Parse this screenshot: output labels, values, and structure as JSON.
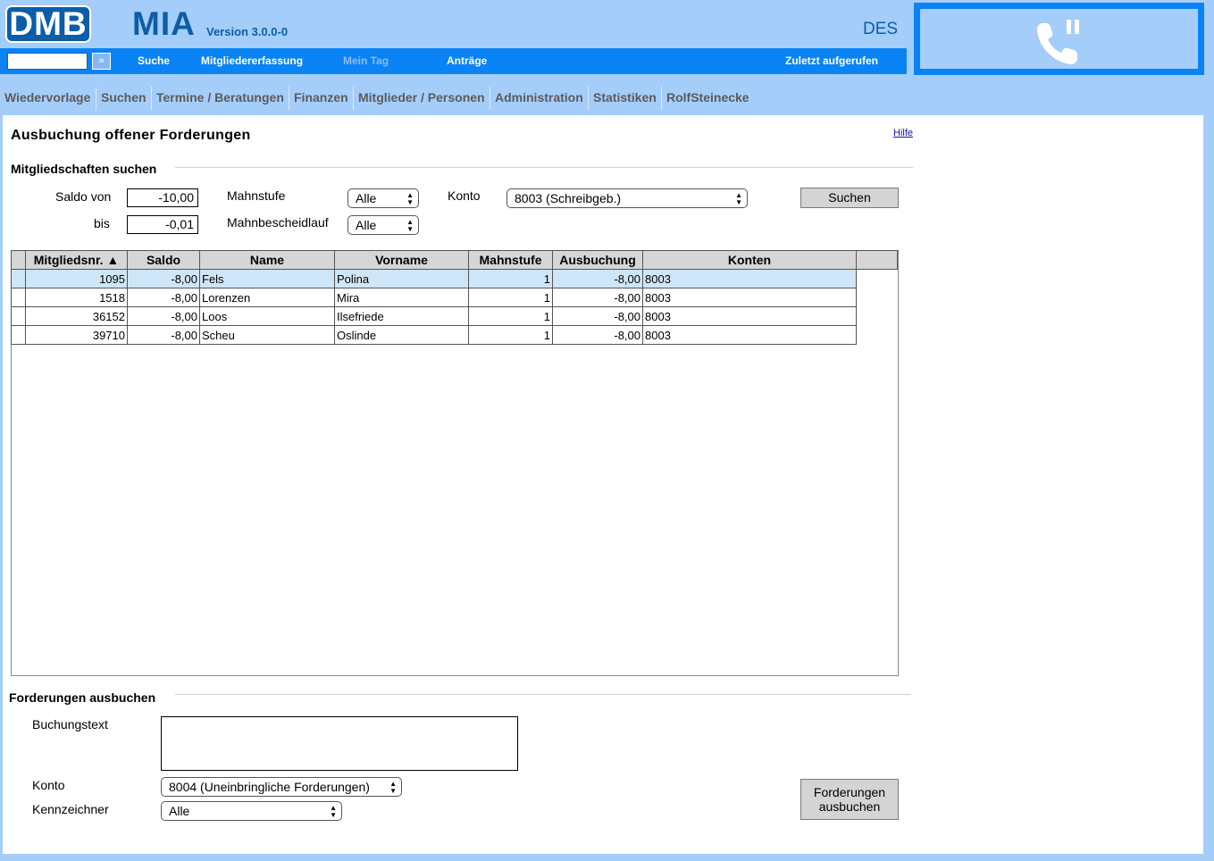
{
  "header": {
    "logo_dmb": "DMB",
    "logo_mia": "MIA",
    "version": "Version 3.0.0-0",
    "user_code": "DES"
  },
  "navbar": {
    "go_label": "»",
    "links": [
      {
        "label": "Suche",
        "enabled": true
      },
      {
        "label": "Mitgliedererfassung",
        "enabled": true
      },
      {
        "label": "Mein Tag",
        "enabled": false
      },
      {
        "label": "Anträge",
        "enabled": true
      },
      {
        "label": "Zuletzt aufgerufen",
        "enabled": true
      }
    ]
  },
  "phone": {
    "icon": "phone-pause-icon"
  },
  "menu": [
    "Wiedervorlage",
    "Suchen",
    "Termine / Beratungen",
    "Finanzen",
    "Mitglieder / Personen",
    "Administration",
    "Statistiken",
    "RolfSteinecke"
  ],
  "page": {
    "title": "Ausbuchung offener Forderungen",
    "help": "Hilfe"
  },
  "search": {
    "section_title": "Mitgliedschaften suchen",
    "saldo_von_label": "Saldo von",
    "saldo_von_value": "-10,00",
    "bis_label": "bis",
    "bis_value": "-0,01",
    "mahnstufe_label": "Mahnstufe",
    "mahnstufe_value": "Alle",
    "mahnbescheidlauf_label": "Mahnbescheidlauf",
    "mahnbescheidlauf_value": "Alle",
    "konto_label": "Konto",
    "konto_value": "8003 (Schreibgeb.)",
    "search_button": "Suchen"
  },
  "table": {
    "columns": [
      "Mitgliedsnr. ▲",
      "Saldo",
      "Name",
      "Vorname",
      "Mahnstufe",
      "Ausbuchung",
      "Konten"
    ],
    "rows": [
      {
        "nr": "1095",
        "saldo": "-8,00",
        "name": "Fels",
        "vorname": "Polina",
        "mahnstufe": "1",
        "ausbuchung": "-8,00",
        "konten": "8003",
        "selected": true
      },
      {
        "nr": "1518",
        "saldo": "-8,00",
        "name": "Lorenzen",
        "vorname": "Mira",
        "mahnstufe": "1",
        "ausbuchung": "-8,00",
        "konten": "8003",
        "selected": false
      },
      {
        "nr": "36152",
        "saldo": "-8,00",
        "name": "Loos",
        "vorname": "Ilsefriede",
        "mahnstufe": "1",
        "ausbuchung": "-8,00",
        "konten": "8003",
        "selected": false
      },
      {
        "nr": "39710",
        "saldo": "-8,00",
        "name": "Scheu",
        "vorname": "Oslinde",
        "mahnstufe": "1",
        "ausbuchung": "-8,00",
        "konten": "8003",
        "selected": false
      }
    ]
  },
  "booking": {
    "section_title": "Forderungen ausbuchen",
    "buchungstext_label": "Buchungstext",
    "buchungstext_value": "",
    "konto_label": "Konto",
    "konto_value": "8004 (Uneinbringliche Forderungen)",
    "kennzeichner_label": "Kennzeichner",
    "kennzeichner_value": "Alle",
    "submit_line1": "Forderungen",
    "submit_line2": "ausbuchen"
  },
  "colors": {
    "background": "#a5cdfa",
    "navbar": "#0a83f5",
    "brand": "#0b5da8",
    "selected_row": "#cfe6f8"
  }
}
